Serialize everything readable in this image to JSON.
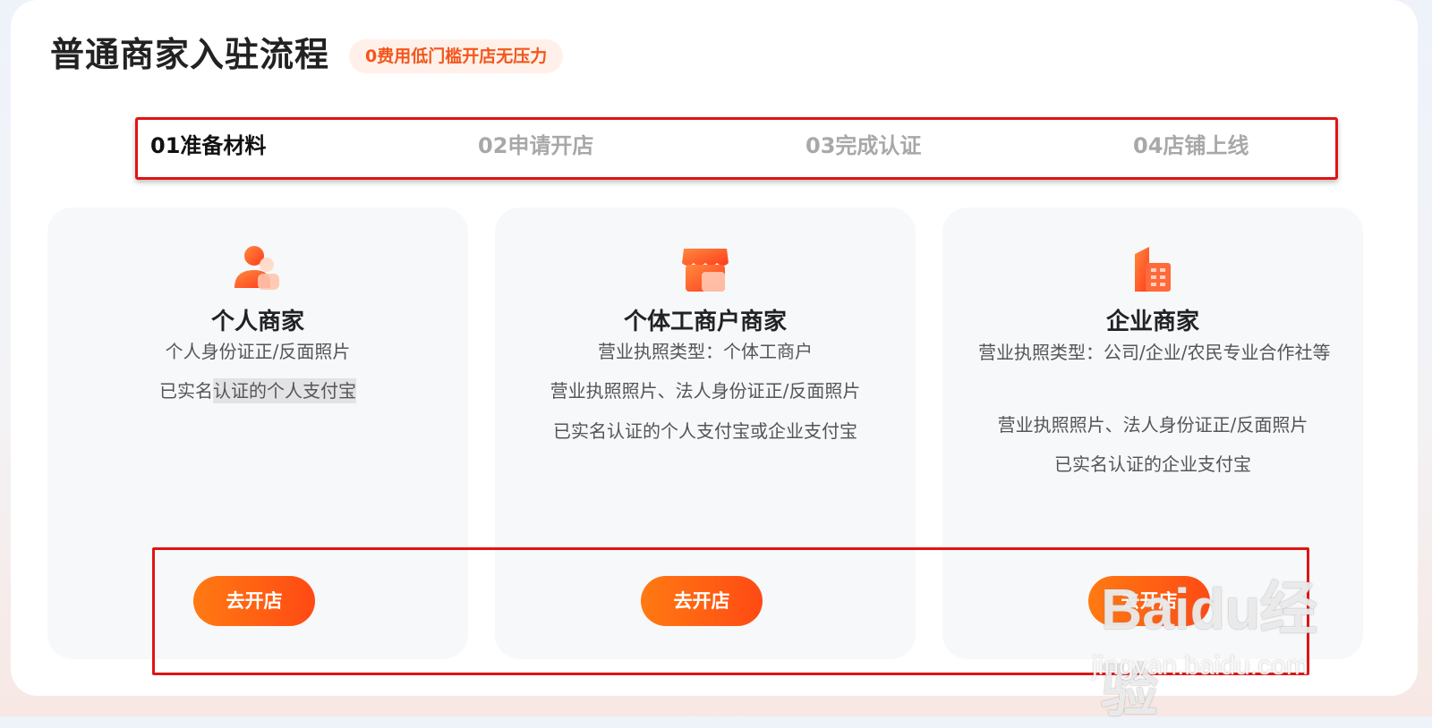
{
  "header": {
    "title": "普通商家入驻流程",
    "badge": "0费用低门槛开店无压力"
  },
  "steps": [
    {
      "label": "01准备材料",
      "active": true
    },
    {
      "label": "02申请开店",
      "active": false
    },
    {
      "label": "03完成认证",
      "active": false
    },
    {
      "label": "04店铺上线",
      "active": false
    }
  ],
  "cards": [
    {
      "icon": "person-icon",
      "title": "个人商家",
      "lines": [
        "个人身份证正/反面照片",
        "已实名",
        "认证的个人支付宝"
      ],
      "button": "去开店"
    },
    {
      "icon": "shop-icon",
      "title": "个体工商户商家",
      "lines": [
        "营业执照类型：个体工商户",
        "营业执照照片、法人身份证正/反面照片",
        "已实名认证的个人支付宝或企业支付宝"
      ],
      "button": "去开店"
    },
    {
      "icon": "building-icon",
      "title": "企业商家",
      "lines": [
        "营业执照类型：公司/企业/农民专业合作社等",
        "营业执照照片、法人身份证正/反面照片",
        "已实名认证的企业支付宝"
      ],
      "button": "去开店"
    }
  ],
  "watermark": {
    "logo": "Baidu经验",
    "url": "jingyan.baidu.com"
  },
  "colors": {
    "accent": "#ff5a14",
    "highlight_box": "#e01414"
  }
}
